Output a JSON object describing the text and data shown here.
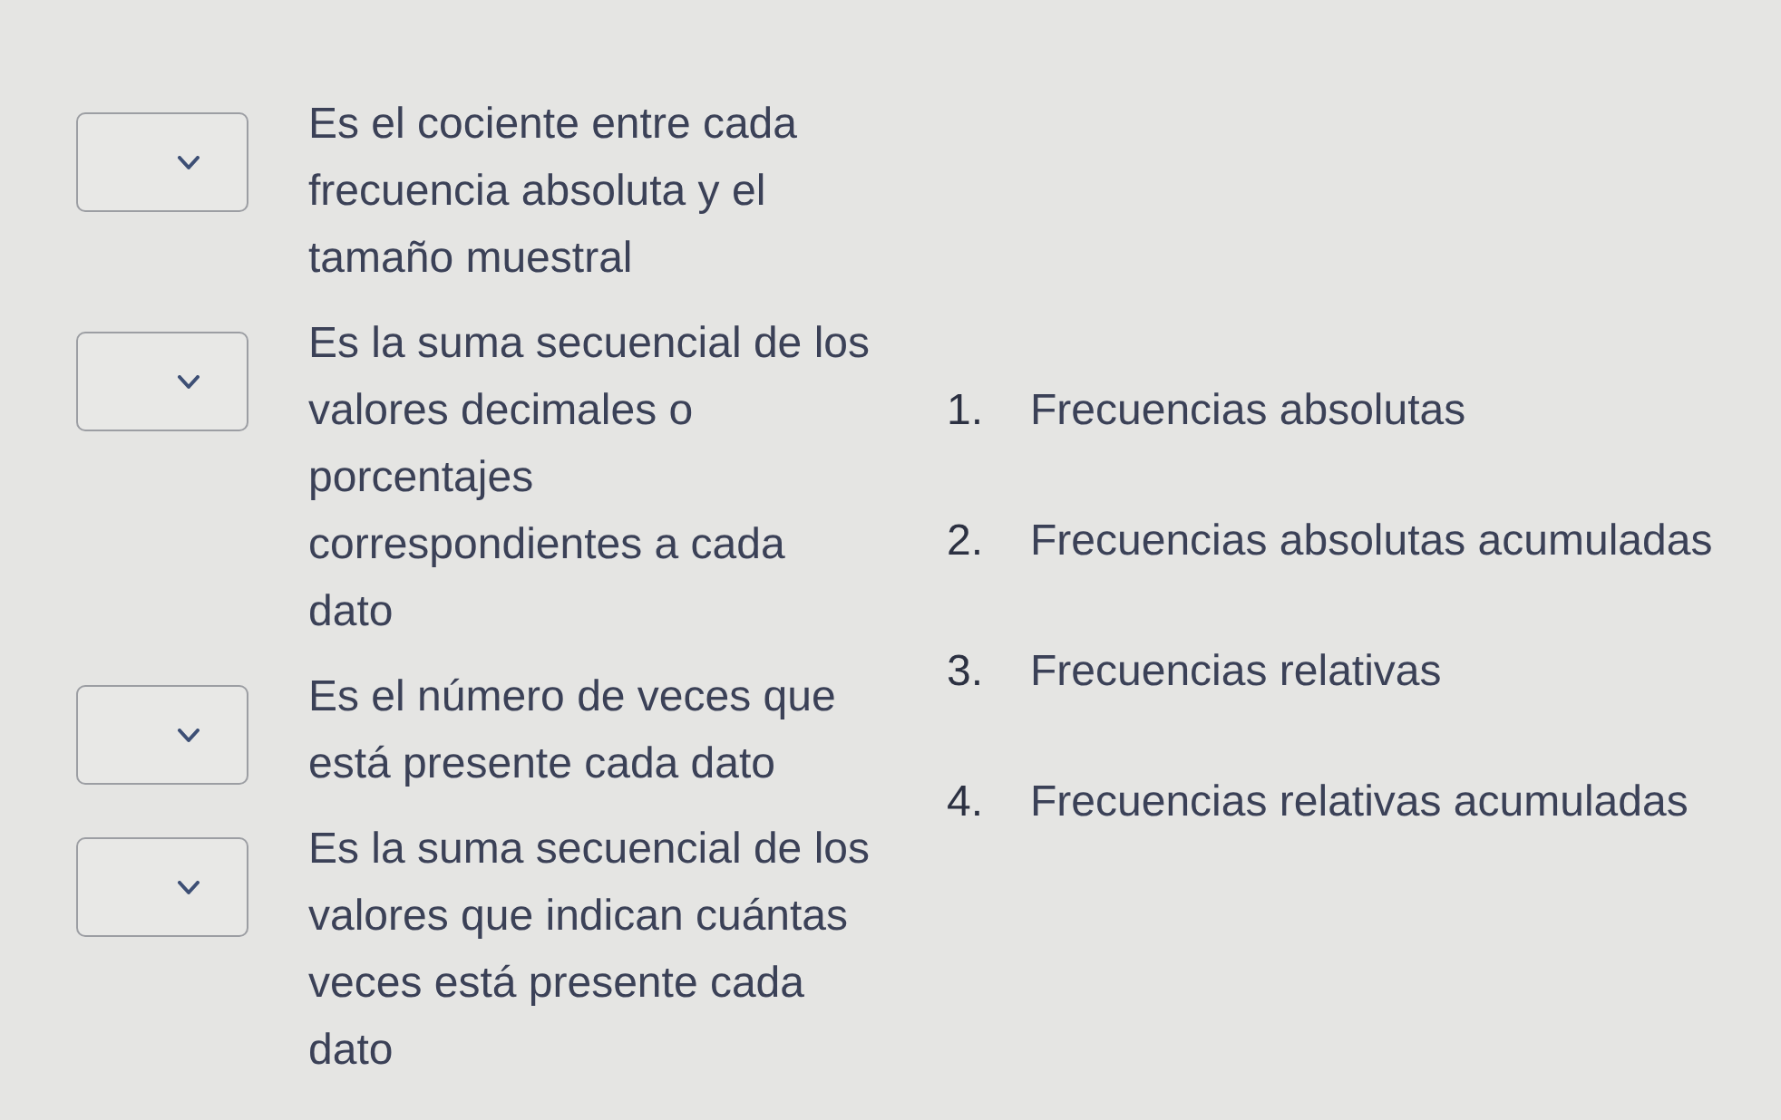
{
  "statements": [
    {
      "text": "Es el cociente entre cada frecuencia absoluta y el tamaño muestral"
    },
    {
      "text": "Es la suma secuencial de los valores decimales o porcentajes correspondientes a cada dato"
    },
    {
      "text": "Es el número de veces que está presente cada dato"
    },
    {
      "text": "Es la suma secuencial de los valores que indican cuántas veces está presente cada dato"
    }
  ],
  "options": [
    {
      "number": "1.",
      "label": "Frecuencias absolutas"
    },
    {
      "number": "2.",
      "label": "Frecuencias absolutas acumuladas"
    },
    {
      "number": "3.",
      "label": "Frecuencias relativas"
    },
    {
      "number": "4.",
      "label": "Frecuencias relativas acumuladas"
    }
  ]
}
